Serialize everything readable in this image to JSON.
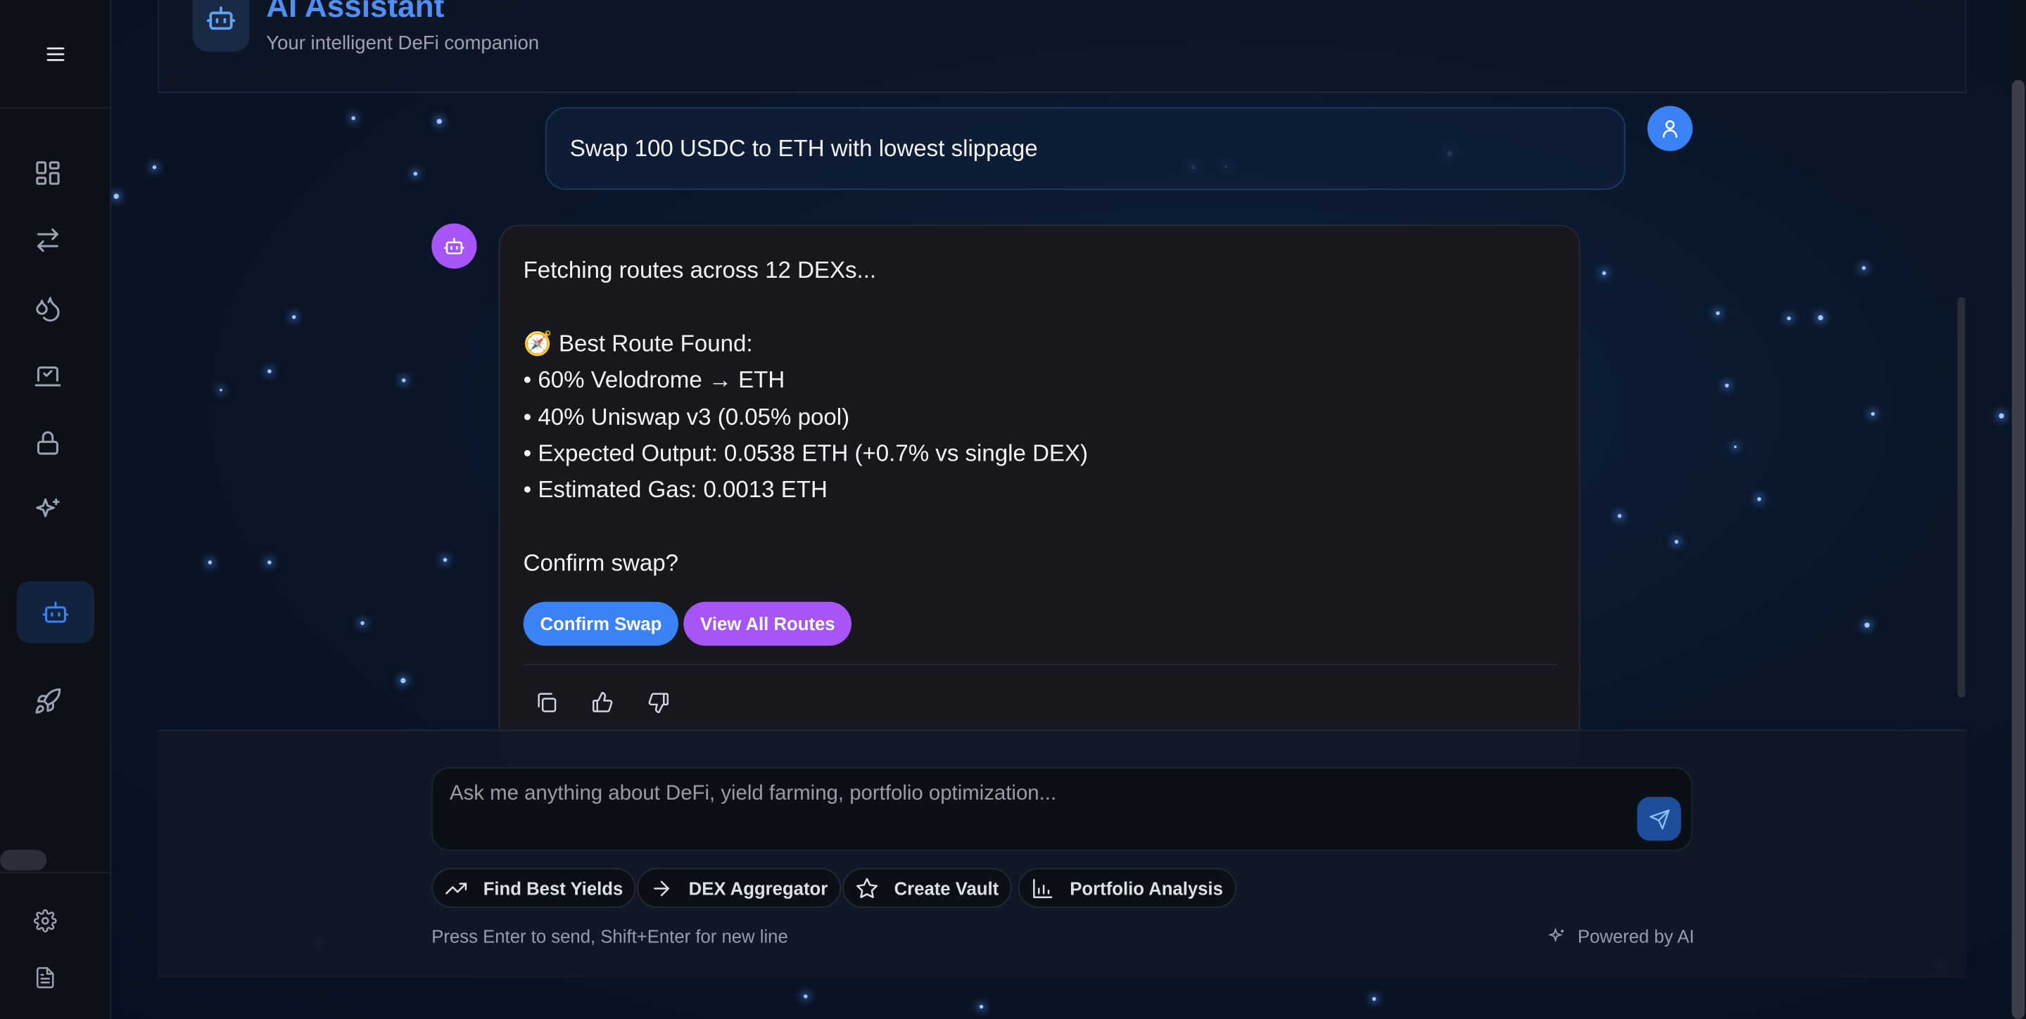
{
  "header": {
    "title": "AI Assistant",
    "subtitle": "Your intelligent DeFi companion"
  },
  "sidebar": {
    "items": [
      {
        "icon": "dashboard-icon"
      },
      {
        "icon": "swap-arrows-icon"
      },
      {
        "icon": "droplets-icon"
      },
      {
        "icon": "vault-check-icon"
      },
      {
        "icon": "lock-icon"
      },
      {
        "icon": "sparkles-icon"
      },
      {
        "icon": "bot-icon",
        "active": true
      },
      {
        "icon": "rocket-icon"
      }
    ],
    "bottom": [
      {
        "icon": "gear-icon"
      },
      {
        "icon": "document-icon"
      }
    ]
  },
  "chat": {
    "user_message": "Swap 100 USDC to ETH with lowest slippage",
    "bot_message": "Fetching routes across 12 DEXs...\n\n🧭 Best Route Found:\n• 60% Velodrome → ETH\n• 40% Uniswap v3 (0.05% pool)\n• Expected Output: 0.0538 ETH (+0.7% vs single DEX)\n• Estimated Gas: 0.0013 ETH\n\nConfirm swap?",
    "confirm_label": "Confirm Swap",
    "routes_label": "View All Routes"
  },
  "input": {
    "placeholder": "Ask me anything about DeFi, yield farming, portfolio optimization...",
    "value": ""
  },
  "quick_actions": [
    {
      "label": "Find Best Yields",
      "icon": "trending-up-icon"
    },
    {
      "label": "DEX Aggregator",
      "icon": "arrow-right-icon"
    },
    {
      "label": "Create Vault",
      "icon": "star-icon"
    },
    {
      "label": "Portfolio Analysis",
      "icon": "bar-chart-icon"
    }
  ],
  "footer": {
    "hint": "Press Enter to send, Shift+Enter for new line",
    "powered": "Powered by AI"
  },
  "colors": {
    "accent_blue": "#3b82f6",
    "accent_purple": "#a855f7",
    "background": "#0a1628"
  }
}
